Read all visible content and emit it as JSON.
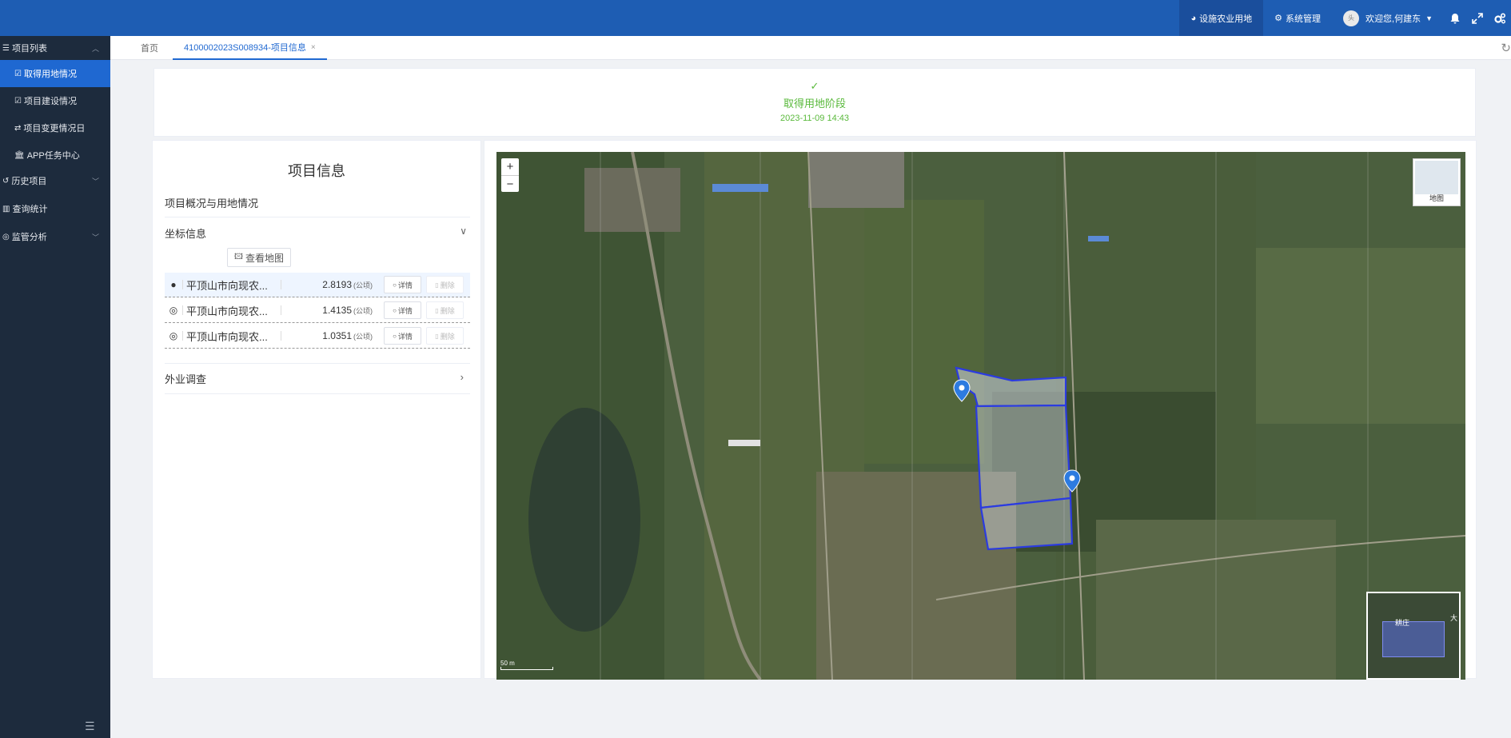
{
  "topbar": {
    "nav": [
      {
        "label": "设施农业用地",
        "icon": "pie-icon",
        "active": true
      },
      {
        "label": "系统管理",
        "icon": "gears-icon",
        "active": false
      }
    ],
    "user": {
      "avatar_text": "头",
      "greeting": "欢迎您,何建东"
    },
    "icons": [
      "bell-icon",
      "fullscreen-icon",
      "settings-icon"
    ]
  },
  "sidebar": {
    "groups": [
      {
        "label": "项目列表",
        "icon": "menu-icon",
        "expanded": true,
        "items": [
          {
            "label": "取得用地情况",
            "icon": "checkbox-icon",
            "active": true
          },
          {
            "label": "项目建设情况",
            "icon": "checkbox-icon",
            "active": false
          },
          {
            "label": "项目变更情况日",
            "icon": "exchange-icon",
            "active": false
          },
          {
            "label": "APP任务中心",
            "icon": "bank-icon",
            "active": false
          }
        ]
      },
      {
        "label": "历史项目",
        "icon": "history-icon"
      },
      {
        "label": "查询统计",
        "icon": "chart-icon"
      },
      {
        "label": "监管分析",
        "icon": "radar-icon"
      }
    ]
  },
  "tabs": [
    {
      "label": "首页",
      "active": false
    },
    {
      "label": "4100002023S008934-项目信息",
      "active": true,
      "close": "×"
    }
  ],
  "stage": {
    "check": "✓",
    "name": "取得用地阶段",
    "time": "2023-11-09 14:43",
    "color": "#59b93b"
  },
  "info": {
    "title": "项目信息",
    "subtitle": "项目概况与用地情况",
    "coord_section": "坐标信息",
    "view_map": "查看地图",
    "unit": "(公顷)",
    "detail_label": "详情",
    "delete_label": "删除",
    "rows": [
      {
        "name": "平顶山市向现农...",
        "area": "2.8193",
        "selected": true
      },
      {
        "name": "平顶山市向现农...",
        "area": "1.4135",
        "selected": false
      },
      {
        "name": "平顶山市向现农...",
        "area": "1.0351",
        "selected": false
      }
    ],
    "survey_section": "外业调查"
  },
  "map": {
    "zoom_in": "+",
    "zoom_out": "−",
    "layer_switch_label": "地图",
    "scale_label": "50 m",
    "overview_labels": [
      "耕庄",
      "大"
    ],
    "polygon_color": "#2b3be0"
  }
}
